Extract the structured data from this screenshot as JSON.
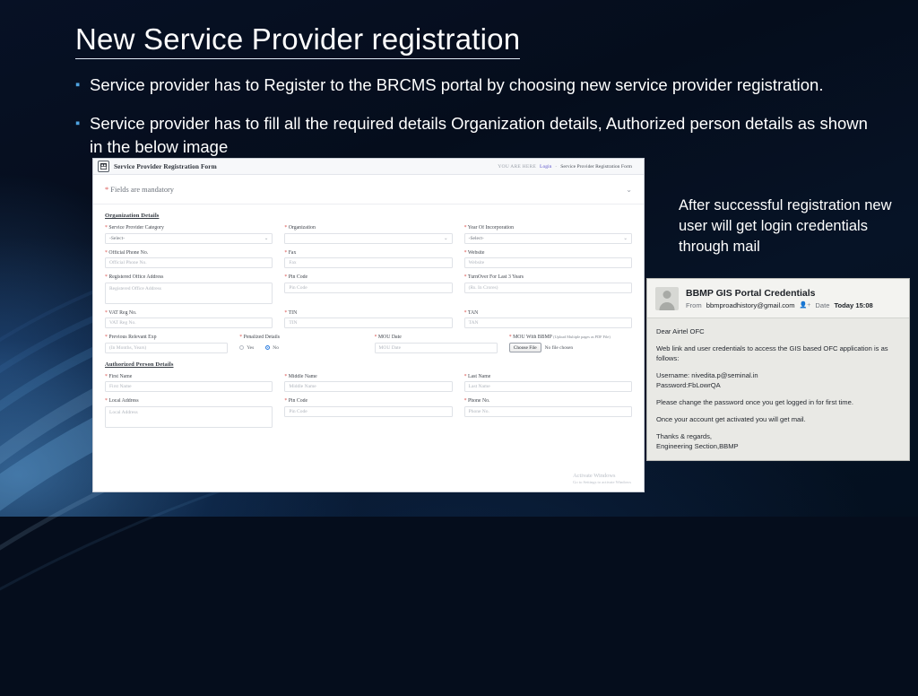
{
  "slide": {
    "title": "New Service Provider registration",
    "bullets": [
      "Service provider has to Register to the BRCMS portal by choosing new service provider registration.",
      "Service provider has to fill all the required details Organization details, Authorized person details as shown in the below image"
    ],
    "right_caption": "After successful registration new user will get login credentials through  mail"
  },
  "form": {
    "window_title": "Service Provider Registration Form",
    "breadcrumb": {
      "here_label": "YOU ARE HERE",
      "login": "Login",
      "separator": "-",
      "current": "Service Provider Registration Form"
    },
    "mandatory_star": "*",
    "mandatory_note": "Fields are mandatory",
    "collapse_icon": "chevron-down-icon",
    "sections": [
      {
        "heading": "Organization Details",
        "rows": [
          [
            {
              "label": "Service Provider Category",
              "required": true,
              "type": "select",
              "value": "-Select-"
            },
            {
              "label": "Organization",
              "required": true,
              "type": "text",
              "placeholder": ""
            },
            {
              "label": "Year Of Incorporation",
              "required": true,
              "type": "select",
              "value": "-Select-"
            }
          ],
          [
            {
              "label": "Official Phone No.",
              "required": true,
              "type": "text",
              "placeholder": "Official Phone No."
            },
            {
              "label": "Fax",
              "required": true,
              "type": "text",
              "placeholder": "Fax"
            },
            {
              "label": "Website",
              "required": true,
              "type": "text",
              "placeholder": "Website"
            }
          ],
          [
            {
              "label": "Registered Office Address",
              "required": true,
              "type": "textarea",
              "placeholder": "Registered Office Address"
            },
            {
              "label": "Pin Code",
              "required": true,
              "type": "text",
              "placeholder": "Pin Code"
            },
            {
              "label": "TurnOver For Last 3 Years",
              "required": true,
              "type": "text",
              "placeholder": "(Rs. In Crores)"
            }
          ],
          [
            {
              "label": "VAT Reg No.",
              "required": true,
              "type": "text",
              "placeholder": "VAT Reg No."
            },
            {
              "label": "TIN",
              "required": true,
              "type": "text",
              "placeholder": "TIN"
            },
            {
              "label": "TAN",
              "required": true,
              "type": "text",
              "placeholder": "TAN"
            }
          ]
        ],
        "mou_row": {
          "exp": {
            "label": "Previous Relevant Exp",
            "required": true,
            "placeholder": "(In Months, Years)"
          },
          "penalized": {
            "label": "Penalized Details",
            "required": true,
            "options": [
              {
                "label": "Yes",
                "selected": false
              },
              {
                "label": "No",
                "selected": true
              }
            ]
          },
          "mou_date": {
            "label": "MOU Date",
            "required": true,
            "placeholder": "MOU Date"
          },
          "mou_file": {
            "label": "MOU With BBMP",
            "hint": "(Upload Multiple pages as PDF File)",
            "required": true,
            "button": "Choose File",
            "status": "No file chosen"
          }
        }
      },
      {
        "heading": "Authorized Person Details",
        "rows": [
          [
            {
              "label": "First Name",
              "required": true,
              "type": "text",
              "placeholder": "First Name"
            },
            {
              "label": "Middle Name",
              "required": true,
              "type": "text",
              "placeholder": "Middle Name"
            },
            {
              "label": "Last Name",
              "required": true,
              "type": "text",
              "placeholder": "Last Name"
            }
          ],
          [
            {
              "label": "Local Address",
              "required": true,
              "type": "textarea",
              "placeholder": "Local Address"
            },
            {
              "label": "Pin Code",
              "required": true,
              "type": "text",
              "placeholder": "Pin Code"
            },
            {
              "label": "Phone No.",
              "required": true,
              "type": "text",
              "placeholder": "Phone No."
            }
          ]
        ]
      }
    ],
    "watermark": {
      "line1": "Activate Windows",
      "line2": "Go to Settings to activate Windows"
    }
  },
  "mail": {
    "subject": "BBMP GIS Portal Credentials",
    "from_label": "From",
    "from_address": "bbmproadhistory@gmail.com",
    "add_person_icon": "add-person-icon",
    "date_label": "Date",
    "date_value": "Today 15:08",
    "avatar_icon": "avatar-icon",
    "body": {
      "greeting": "Dear Airtel OFC",
      "intro": "Web link and user credentials to access the GIS based OFC application is as follows:",
      "username": "Username: nivedita.p@seminal.in",
      "password": "Password:FbLowrQA",
      "note1": "Please change the password once you get logged in for first time.",
      "note2": "Once your account get activated you will get mail.",
      "signoff1": "Thanks & regards,",
      "signoff2": "Engineering Section,BBMP"
    }
  },
  "colors": {
    "accent_blue": "#4ea3e0",
    "required_red": "#d9534f",
    "link_purple": "#5b54c9",
    "radio_blue": "#2f7fe0"
  }
}
